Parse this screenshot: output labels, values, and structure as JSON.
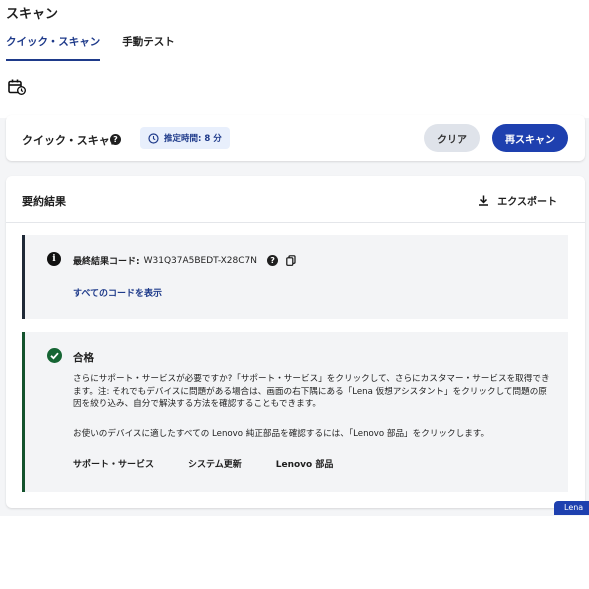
{
  "page": {
    "title": "スキャン"
  },
  "tabs": [
    {
      "label": "クイック・スキャン",
      "active": true
    },
    {
      "label": "手動テスト",
      "active": false
    }
  ],
  "toolbar": {
    "history_icon": "calendar-history-icon"
  },
  "scan": {
    "title": "クイック・スキャン",
    "help_icon": "question-circle-icon",
    "estimate": "推定時間: 8 分",
    "clear_label": "クリア",
    "rescan_label": "再スキャン"
  },
  "summary": {
    "title": "要約結果",
    "export_label": "エクスポート",
    "code_label": "最終結果コード:",
    "code_value": "W31Q37A5BEDT-X28C7N",
    "view_all_label": "すべてのコードを表示",
    "status_title": "合格",
    "status_text_1": "さらにサポート・サービスが必要ですか?「サポート・サービス」をクリックして、さらにカスタマー・サービスを取得できます。注: それでもデバイスに問題がある場合は、画面の右下隅にある「Lena 仮想アシスタント」をクリックして問題の原因を絞り込み、自分で解決する方法を確認することもできます。",
    "status_text_2": "お使いのデバイスに適したすべての Lenovo 純正部品を確認するには、「Lenovo 部品」をクリックします。",
    "links": [
      "サポート・サービス",
      "システム更新",
      "Lenovo 部品"
    ]
  },
  "corner_button": {
    "label": "Lena"
  },
  "colors": {
    "accent": "#1e40af",
    "pass": "#166534",
    "panel_bg": "#f3f4f6"
  }
}
